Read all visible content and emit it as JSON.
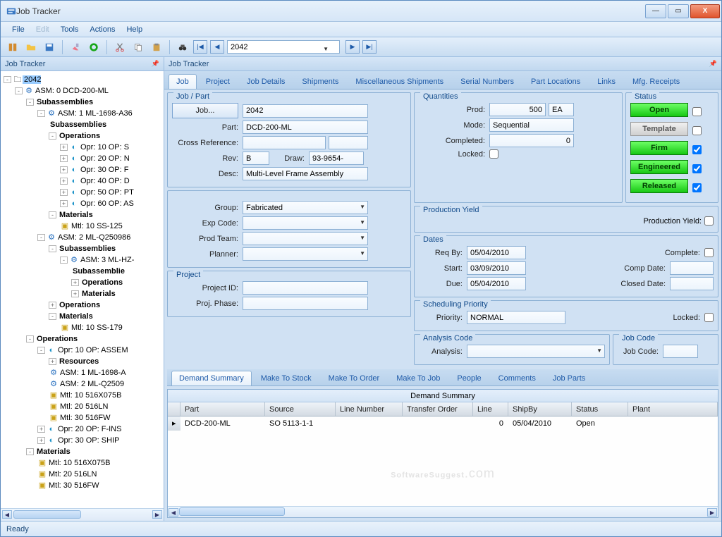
{
  "window_title": "Job Tracker",
  "menu": {
    "File": "File",
    "Edit": "Edit",
    "Tools": "Tools",
    "Actions": "Actions",
    "Help": "Help"
  },
  "toolbar_search": "2042",
  "sidebar_title": "Job Tracker",
  "main_title": "Job Tracker",
  "tree": {
    "root": "2042",
    "asm0": "ASM: 0 DCD-200-ML",
    "subassemblies": "Subassemblies",
    "asm1": "ASM: 1 ML-1698-A36",
    "operations": "Operations",
    "op10s": "Opr: 10 OP: S",
    "op20n": "Opr: 20 OP: N",
    "op30f": "Opr: 30 OP: F",
    "op40d": "Opr: 40 OP: D",
    "op50pt": "Opr: 50 OP: PT",
    "op60as": "Opr: 60 OP: AS",
    "materials": "Materials",
    "mtl10ss125": "Mtl: 10 SS-125",
    "asm2": "ASM: 2 ML-Q250986",
    "asm3": "ASM: 3 ML-HZ-",
    "subassemblie": "Subassemblie",
    "mtl10ss179": "Mtl: 10 SS-179",
    "op10assem": "Opr: 10 OP: ASSEM",
    "resources": "Resources",
    "asm1r": "ASM: 1 ML-1698-A",
    "asm2r": "ASM: 2 ML-Q2509",
    "mtl10_516x": "Mtl: 10 516X075B",
    "mtl20_516ln": "Mtl: 20 516LN",
    "mtl30_516fw": "Mtl: 30 516FW",
    "op20fins": "Opr: 20 OP: F-INS",
    "op30ship": "Opr: 30 OP: SHIP",
    "mtl10b": "Mtl: 10 516X075B",
    "mtl20b": "Mtl: 20 516LN",
    "mtl30b": "Mtl: 30 516FW"
  },
  "tabs": {
    "job": "Job",
    "project": "Project",
    "jobdetails": "Job Details",
    "shipments": "Shipments",
    "miscship": "Miscellaneous Shipments",
    "serial": "Serial Numbers",
    "partloc": "Part Locations",
    "links": "Links",
    "mfgrec": "Mfg. Receipts"
  },
  "jobpart": {
    "legend": "Job / Part",
    "job_btn": "Job...",
    "job": "2042",
    "part_lbl": "Part:",
    "part": "DCD-200-ML",
    "cross_lbl": "Cross Reference:",
    "cross": "",
    "rev_lbl": "Rev:",
    "rev": "B",
    "draw_lbl": "Draw:",
    "draw": "93-9654-",
    "desc_lbl": "Desc:",
    "desc": "Multi-Level Frame Assembly",
    "group_lbl": "Group:",
    "group": "Fabricated",
    "expcode_lbl": "Exp Code:",
    "expcode": "",
    "prodteam_lbl": "Prod Team:",
    "prodteam": "",
    "planner_lbl": "Planner:",
    "planner": ""
  },
  "project": {
    "legend": "Project",
    "projid_lbl": "Project ID:",
    "projid": "",
    "phase_lbl": "Proj. Phase:",
    "phase": ""
  },
  "quantities": {
    "legend": "Quantities",
    "prod_lbl": "Prod:",
    "prod": "500",
    "uom": "EA",
    "mode_lbl": "Mode:",
    "mode": "Sequential",
    "completed_lbl": "Completed:",
    "completed": "0",
    "locked_lbl": "Locked:"
  },
  "prodyield": {
    "legend": "Production Yield",
    "lbl": "Production Yield:"
  },
  "dates": {
    "legend": "Dates",
    "reqby_lbl": "Req By:",
    "reqby": "05/04/2010",
    "start_lbl": "Start:",
    "start": "03/09/2010",
    "due_lbl": "Due:",
    "due": "05/04/2010",
    "complete_lbl": "Complete:",
    "compdate_lbl": "Comp Date:",
    "compdate": "",
    "closed_lbl": "Closed Date:",
    "closed": ""
  },
  "sched": {
    "legend": "Scheduling Priority",
    "priority_lbl": "Priority:",
    "priority": "NORMAL",
    "locked_lbl": "Locked:"
  },
  "analysis": {
    "legend": "Analysis Code",
    "lbl": "Analysis:",
    "val": ""
  },
  "jobcode": {
    "legend": "Job Code",
    "lbl": "Job Code:",
    "val": ""
  },
  "status": {
    "legend": "Status",
    "open": "Open",
    "template": "Template",
    "firm": "Firm",
    "engineered": "Engineered",
    "released": "Released"
  },
  "subtabs": {
    "demand": "Demand Summary",
    "mts": "Make To Stock",
    "mto": "Make To Order",
    "mtj": "Make To Job",
    "people": "People",
    "comments": "Comments",
    "jobparts": "Job Parts"
  },
  "grid": {
    "title": "Demand Summary",
    "headers": {
      "part": "Part",
      "source": "Source",
      "lineno": "Line Number",
      "transorder": "Transfer Order",
      "line": "Line",
      "shipby": "ShipBy",
      "status": "Status",
      "plant": "Plant"
    },
    "rows": [
      {
        "part": "DCD-200-ML",
        "source": "SO 5113-1-1",
        "lineno": "",
        "transorder": "",
        "line": "0",
        "shipby": "05/04/2010",
        "status": "Open",
        "plant": ""
      }
    ]
  },
  "status_text": "Ready",
  "watermark": "SoftwareSuggest",
  "watermark_dot": ".com"
}
